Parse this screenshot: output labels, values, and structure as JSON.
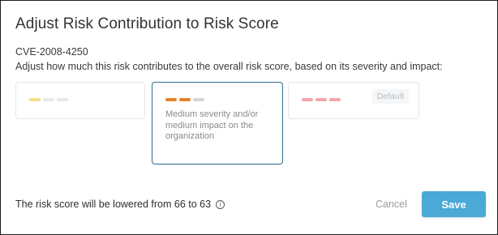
{
  "dialog": {
    "title": "Adjust Risk Contribution to Risk Score",
    "cve_id": "CVE-2008-4250",
    "description": "Adjust how much this risk contributes to the overall risk score, based on its severity and impact:"
  },
  "options": {
    "low": {
      "selected": false,
      "dash_colors": [
        "#f6df8a",
        "#e8e8e8",
        "#e8e8e8"
      ]
    },
    "medium": {
      "selected": true,
      "description": "Medium severity and/or medium impact on the organization",
      "dash_colors": [
        "#e8812c",
        "#e8812c",
        "#d6d6d6"
      ]
    },
    "high": {
      "selected": false,
      "badge": "Default",
      "dash_colors": [
        "#f2a7ab",
        "#f2a7ab",
        "#f2a7ab"
      ]
    }
  },
  "footer": {
    "risk_message": "The risk score will be lowered from 66 to 63",
    "info_glyph": "i",
    "cancel_label": "Cancel",
    "save_label": "Save"
  },
  "colors": {
    "selected_border": "#2e6f8e",
    "save_button": "#4aa9d6"
  },
  "icons": {
    "info": "info-circle-icon"
  }
}
